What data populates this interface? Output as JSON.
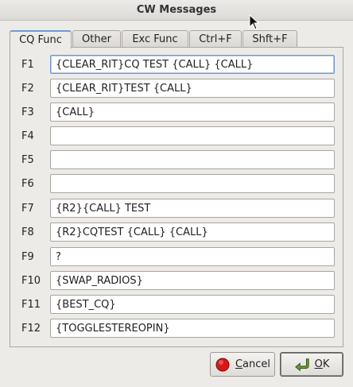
{
  "window": {
    "title": "CW Messages"
  },
  "tabs": [
    {
      "label": "CQ Func",
      "active": true
    },
    {
      "label": "Other",
      "active": false
    },
    {
      "label": "Exc Func",
      "active": false
    },
    {
      "label": "Ctrl+F",
      "active": false
    },
    {
      "label": "Shft+F",
      "active": false
    }
  ],
  "messages": [
    {
      "key": "F1",
      "value": "{CLEAR_RIT}CQ TEST {CALL} {CALL}"
    },
    {
      "key": "F2",
      "value": "{CLEAR_RIT}TEST {CALL}"
    },
    {
      "key": "F3",
      "value": "{CALL}"
    },
    {
      "key": "F4",
      "value": ""
    },
    {
      "key": "F5",
      "value": ""
    },
    {
      "key": "F6",
      "value": ""
    },
    {
      "key": "F7",
      "value": "{R2}{CALL} TEST"
    },
    {
      "key": "F8",
      "value": "{R2}CQTEST {CALL} {CALL}"
    },
    {
      "key": "F9",
      "value": "?"
    },
    {
      "key": "F10",
      "value": "{SWAP_RADIOS}"
    },
    {
      "key": "F11",
      "value": "{BEST_CQ}"
    },
    {
      "key": "F12",
      "value": "{TOGGLESTEREOPIN}"
    }
  ],
  "buttons": {
    "cancel": {
      "mnemonic": "C",
      "rest": "ancel",
      "icon": "stop-icon"
    },
    "ok": {
      "mnemonic": "O",
      "rest": "K",
      "icon": "return-arrow-icon"
    }
  },
  "colors": {
    "focus": "#6f9bd1",
    "stop": "#d81818",
    "ok_arrow": "#5a8a2a"
  }
}
